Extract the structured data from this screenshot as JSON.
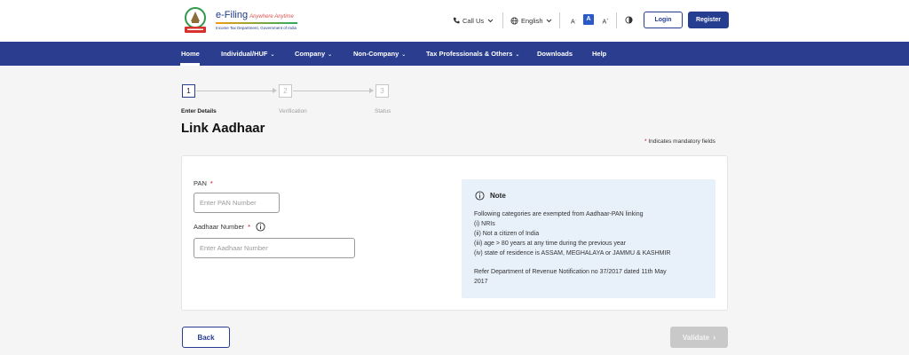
{
  "header": {
    "logo_title": "e-Filing",
    "logo_tagline": "Anywhere Anytime",
    "logo_subtitle": "Income Tax Department, Government of India",
    "call_us": "Call Us",
    "language": "English",
    "font_decrease": "A",
    "font_normal": "A",
    "font_increase": "A",
    "login_label": "Login",
    "register_label": "Register"
  },
  "nav": {
    "items": [
      {
        "label": "Home"
      },
      {
        "label": "Individual/HUF"
      },
      {
        "label": "Company"
      },
      {
        "label": "Non-Company"
      },
      {
        "label": "Tax Professionals & Others"
      },
      {
        "label": "Downloads"
      },
      {
        "label": "Help"
      }
    ]
  },
  "stepper": {
    "steps": [
      {
        "number": "1",
        "label": "Enter Details"
      },
      {
        "number": "2",
        "label": "Verification"
      },
      {
        "number": "3",
        "label": "Status"
      }
    ]
  },
  "page": {
    "title": "Link Aadhaar",
    "mandatory_note": "Indicates mandatory fields"
  },
  "form": {
    "pan_label": "PAN",
    "pan_placeholder": "Enter PAN Number",
    "pan_value": "",
    "aadhaar_label": "Aadhaar Number",
    "aadhaar_placeholder": "Enter Aadhaar Number",
    "aadhaar_value": ""
  },
  "note": {
    "title": "Note",
    "lines": [
      "Following categories are exempted from Aadhaar-PAN linking",
      "(i) NRIs",
      "(ii) Not a citizen of India",
      "(iii) age > 80 years at any time during the previous year",
      "(iv) state of residence is ASSAM, MEGHALAYA or JAMMU & KASHMIR",
      "Refer Department of Revenue Notification no 37/2017 dated 11th May",
      "2017"
    ]
  },
  "actions": {
    "back_label": "Back",
    "validate_label": "Validate"
  },
  "colors": {
    "primary": "#263e8f",
    "nav_background": "#2b3d8e",
    "required": "#d0021b",
    "note_background": "#e8f0fa",
    "disabled": "#c9c9c9"
  }
}
